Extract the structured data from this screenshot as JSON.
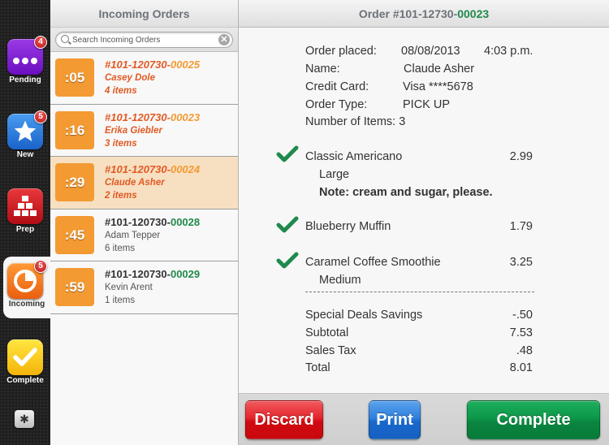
{
  "sidebar": {
    "items": [
      {
        "label": "Pending",
        "badge": "4",
        "icon": "ellipsis-icon"
      },
      {
        "label": "New",
        "badge": "5",
        "icon": "star-icon"
      },
      {
        "label": "Prep",
        "badge": null,
        "icon": "stacked-blocks-icon"
      },
      {
        "label": "Incoming",
        "badge": "5",
        "icon": "timer-icon",
        "active": true
      },
      {
        "label": "Complete",
        "badge": null,
        "icon": "checkmark-icon"
      }
    ],
    "settings_icon": "gear-icon",
    "settings_glyph": "✱"
  },
  "orders_pane": {
    "title": "Incoming Orders",
    "search": {
      "placeholder": "Search Incoming Orders",
      "value": "",
      "clear_glyph": "✕"
    },
    "orders": [
      {
        "timer": ":05",
        "prefix": "#101-120730-",
        "suffix": "00025",
        "name": "Casey Dole",
        "items": "4 items",
        "status": "new"
      },
      {
        "timer": ":16",
        "prefix": "#101-120730-",
        "suffix": "00023",
        "name": "Erika Giebler",
        "items": "3 items",
        "status": "new"
      },
      {
        "timer": ":29",
        "prefix": "#101-120730-",
        "suffix": "00024",
        "name": "Claude Asher",
        "items": "2 items",
        "status": "new",
        "selected": true
      },
      {
        "timer": ":45",
        "prefix": "#101-120730-",
        "suffix": "00028",
        "name": "Adam Tepper",
        "items": "6 items",
        "status": "old"
      },
      {
        "timer": ":59",
        "prefix": "#101-120730-",
        "suffix": "00029",
        "name": "Kevin Arent",
        "items": "1 items",
        "status": "old"
      }
    ]
  },
  "detail": {
    "title_prefix": "Order #101-12730-",
    "title_suffix": "00023",
    "info": {
      "order_placed_label": "Order placed:",
      "order_date": "08/08/2013",
      "order_time": "4:03 p.m.",
      "name_label": "Name:",
      "name": "Claude Asher",
      "card_label": "Credit Card:",
      "card": "Visa ****5678",
      "type_label": "Order Type:",
      "type": "PICK UP",
      "count_label": "Number of Items:",
      "count": "3"
    },
    "items": [
      {
        "name": "Classic Americano",
        "price": "2.99",
        "size": "Large",
        "note": "Note: cream and sugar, please.",
        "checked": true
      },
      {
        "name": "Blueberry Muffin",
        "price": "1.79",
        "checked": true
      },
      {
        "name": "Caramel Coffee Smoothie",
        "price": "3.25",
        "size": "Medium",
        "checked": true
      }
    ],
    "totals": [
      {
        "label": "Special Deals Savings",
        "amount": "-.50"
      },
      {
        "label": "Subtotal",
        "amount": "7.53"
      },
      {
        "label": "Sales Tax",
        "amount": ".48"
      },
      {
        "label": "Total",
        "amount": "8.01"
      }
    ],
    "actions": {
      "discard": "Discard",
      "print": "Print",
      "complete": "Complete"
    }
  },
  "colors": {
    "accent_orange": "#f39a33",
    "new_order_text": "#e15a25",
    "green": "#1f8a4c",
    "discard_red": "#e5262c",
    "print_blue": "#2f7fdc",
    "complete_green": "#0d9749",
    "selected_row": "#f7dfc1"
  }
}
